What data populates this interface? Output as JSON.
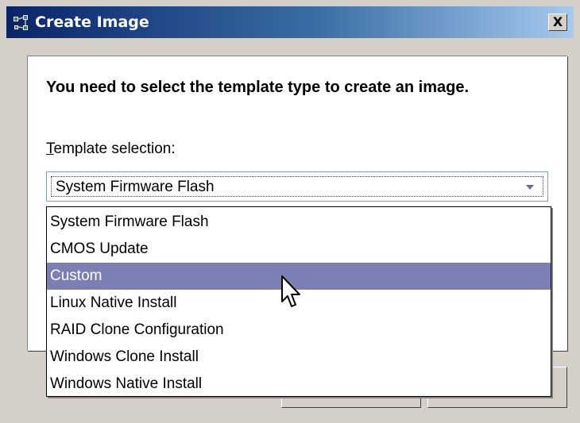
{
  "window": {
    "title": "Create Image",
    "close_label": "X",
    "app_icon": "network-nodes-icon"
  },
  "dialog": {
    "instruction": "You need to select the template type to create an image.",
    "template_label_mnemonic": "T",
    "template_label_rest": "emplate selection:",
    "selected_value": "System Firmware Flash",
    "options": [
      "System Firmware Flash",
      "CMOS Update",
      "Custom",
      "Linux Native Install",
      "RAID Clone Configuration",
      "Windows Clone Install",
      "Windows Native Install"
    ],
    "highlighted_option": "Custom"
  },
  "colors": {
    "title_start": "#0a246a",
    "title_end": "#a6caf0",
    "highlight": "#7c7fb4",
    "face": "#d4d0c8"
  }
}
